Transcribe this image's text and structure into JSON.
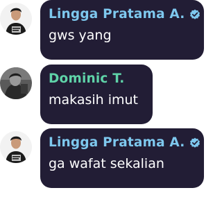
{
  "colors": {
    "bubble": "#221d35",
    "name_lingga": "#7ec8ee",
    "name_dominic": "#5fd3a8",
    "verified_badge": "#7ec8ee"
  },
  "messages": [
    {
      "author": "Lingga Pratama A.",
      "verified": true,
      "avatar_icon": "avatar-person-dark-shirt",
      "text": "gws yang"
    },
    {
      "author": "Dominic T.",
      "verified": false,
      "avatar_icon": "avatar-grayscale-photo",
      "text": "makasih imut"
    },
    {
      "author": "Lingga Pratama A.",
      "verified": true,
      "avatar_icon": "avatar-person-dark-shirt",
      "text": "ga wafat sekalian"
    }
  ]
}
